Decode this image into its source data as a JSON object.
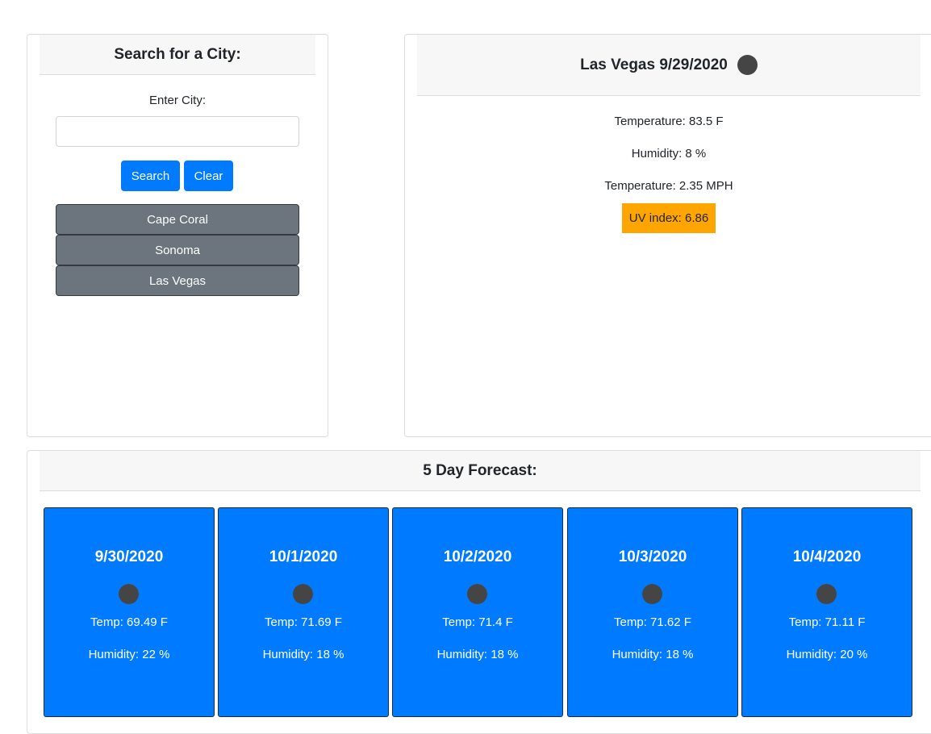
{
  "search": {
    "header": "Search for a City:",
    "input_label": "Enter City:",
    "input_value": "",
    "search_label": "Search",
    "clear_label": "Clear",
    "history": [
      "Cape Coral",
      "Sonoma",
      "Las Vegas"
    ]
  },
  "current": {
    "title": "Las Vegas 9/29/2020",
    "icon": "weather-icon",
    "temperature": "Temperature: 83.5 F",
    "humidity": "Humidity: 8 %",
    "wind": "Temperature: 2.35 MPH",
    "uv": "UV index: 6.86",
    "uv_color": "#ffa500"
  },
  "forecast": {
    "header": "5 Day Forecast:",
    "days": [
      {
        "date": "9/30/2020",
        "temp": "Temp: 69.49 F",
        "humidity": "Humidity: 22 %"
      },
      {
        "date": "10/1/2020",
        "temp": "Temp: 71.69 F",
        "humidity": "Humidity: 18 %"
      },
      {
        "date": "10/2/2020",
        "temp": "Temp: 71.4 F",
        "humidity": "Humidity: 18 %"
      },
      {
        "date": "10/3/2020",
        "temp": "Temp: 71.62 F",
        "humidity": "Humidity: 18 %"
      },
      {
        "date": "10/4/2020",
        "temp": "Temp: 71.11 F",
        "humidity": "Humidity: 20 %"
      }
    ]
  },
  "colors": {
    "primary": "#007bff",
    "secondary": "#6c757d",
    "uv_moderate": "#ffa500"
  }
}
